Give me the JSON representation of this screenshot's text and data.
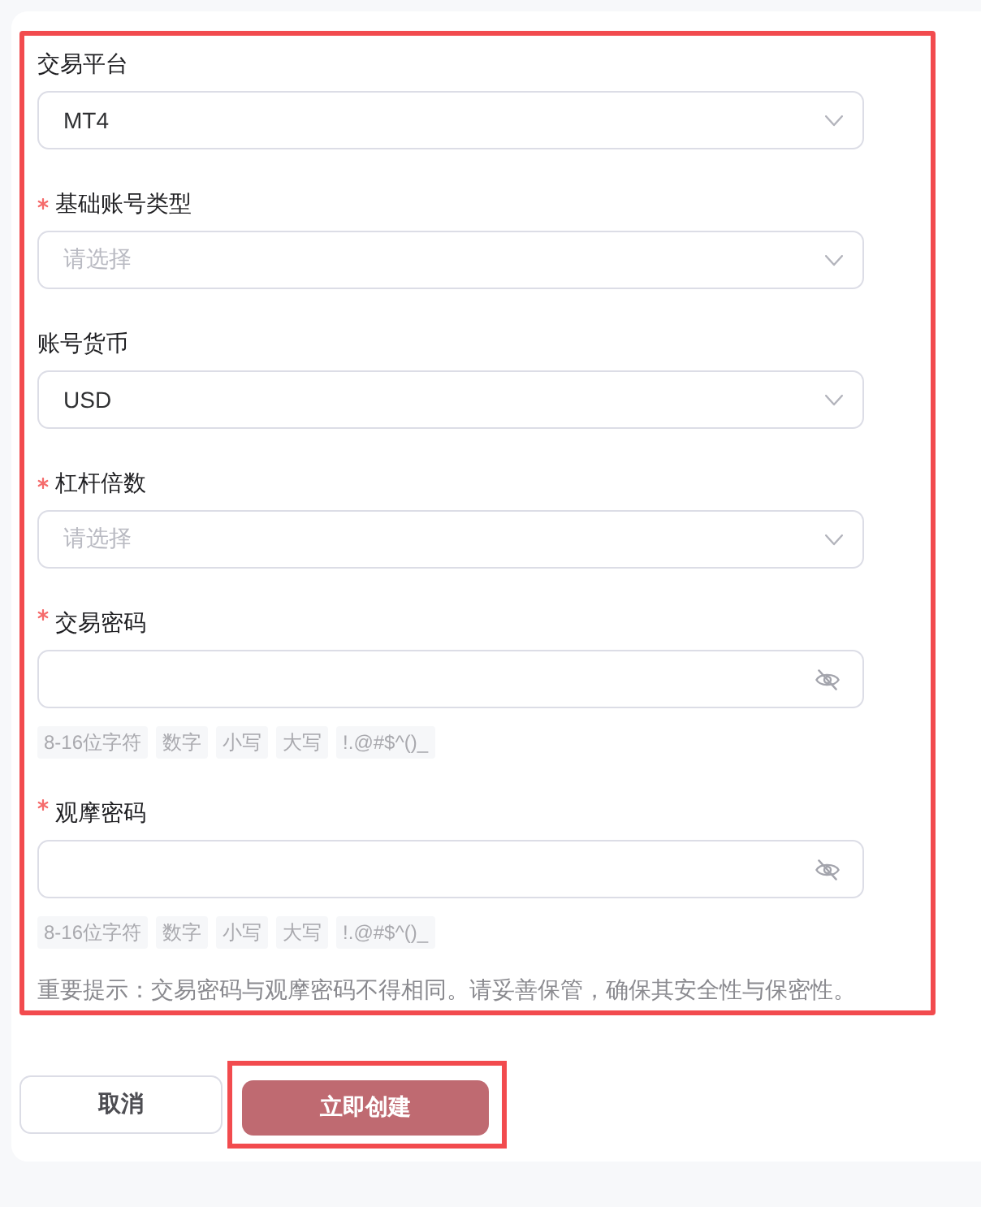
{
  "form": {
    "highlighted": true,
    "fields": [
      {
        "kind": "select",
        "label": "交易平台",
        "required": false,
        "value": "MT4"
      },
      {
        "kind": "select",
        "label": "基础账号类型",
        "required": true,
        "placeholder": "请选择"
      },
      {
        "kind": "select",
        "label": "账号货币",
        "required": false,
        "value": "USD"
      },
      {
        "kind": "select",
        "label": "杠杆倍数",
        "required": true,
        "placeholder": "请选择"
      },
      {
        "kind": "password",
        "label": "交易密码",
        "required": true,
        "rules": [
          "8-16位字符",
          "数字",
          "小写",
          "大写",
          "!.@#$^()_"
        ]
      },
      {
        "kind": "password",
        "label": "观摩密码",
        "required": true,
        "rules": [
          "8-16位字符",
          "数字",
          "小写",
          "大写",
          "!.@#$^()_"
        ]
      }
    ],
    "note": "重要提示：交易密码与观摩密码不得相同。请妥善保管，确保其安全性与保密性。"
  },
  "buttons": [
    {
      "kind": "secondary",
      "label": "取消",
      "highlighted": false
    },
    {
      "kind": "primary",
      "label": "立即创建",
      "highlighted": true
    }
  ]
}
